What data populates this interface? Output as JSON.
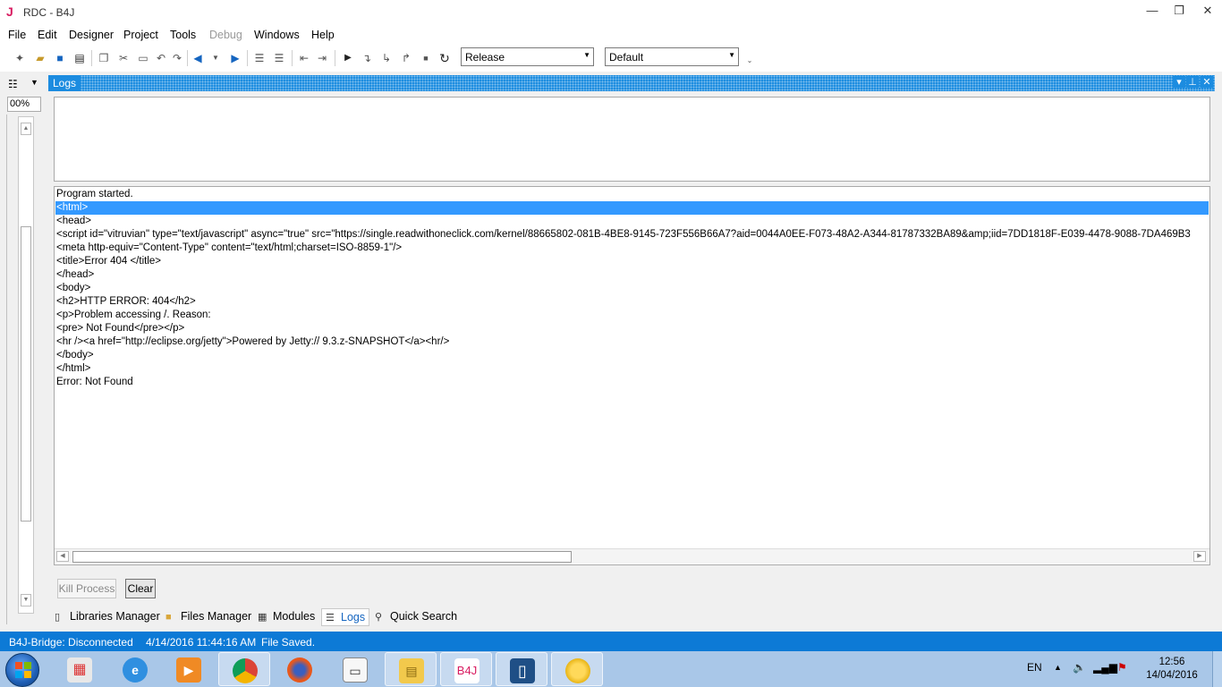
{
  "window": {
    "app_icon": "J",
    "title": "RDC - B4J",
    "controls": {
      "minimize": "—",
      "maximize": "❐",
      "close": "✕"
    }
  },
  "menu": {
    "file": "File",
    "edit": "Edit",
    "designer": "Designer",
    "project": "Project",
    "tools": "Tools",
    "debug": "Debug",
    "windows": "Windows",
    "help": "Help"
  },
  "toolbar": {
    "build_config": "Release",
    "build_target": "Default"
  },
  "left_panel": {
    "zoom": "00%"
  },
  "logs_panel": {
    "title": "Logs",
    "lines": [
      "Program started.",
      "<html>",
      "<head>",
      " <script id=\"vitruvian\" type=\"text/javascript\" async=\"true\" src=\"https://single.readwithoneclick.com/kernel/88665802-081B-4BE8-9145-723F556B66A7?aid=0044A0EE-F073-48A2-A344-81787332BA89&amp;iid=7DD1818F-E039-4478-9088-7DA469B3",
      "<meta http-equiv=\"Content-Type\" content=\"text/html;charset=ISO-8859-1\"/>",
      "<title>Error 404 </title>",
      "</head>",
      "<body>",
      "<h2>HTTP ERROR: 404</h2>",
      "<p>Problem accessing /. Reason:",
      "<pre>    Not Found</pre></p>",
      "<hr /><a href=\"http://eclipse.org/jetty\">Powered by Jetty:// 9.3.z-SNAPSHOT</a><hr/>",
      "</body>",
      "</html>",
      "Error: Not Found"
    ],
    "kill_process_label": "Kill Process",
    "clear_label": "Clear"
  },
  "bottom_tabs": {
    "libraries": "Libraries Manager",
    "files": "Files Manager",
    "modules": "Modules",
    "logs": "Logs",
    "quick_search": "Quick Search"
  },
  "status": {
    "bridge": "B4J-Bridge: Disconnected",
    "timestamp": "4/14/2016 11:44:16 AM",
    "message": "File Saved."
  },
  "taskbar": {
    "b4j_label": "B4J",
    "language": "EN",
    "time": "12:56",
    "date": "14/04/2016"
  },
  "colors": {
    "accent": "#1c8ce0",
    "status_bar": "#0d7ad6",
    "selection": "#3399ff"
  }
}
